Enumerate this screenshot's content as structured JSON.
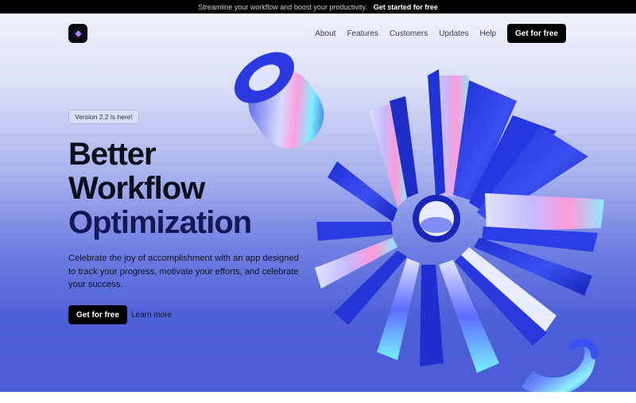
{
  "announcement": {
    "text": "Streamline your workflow and boost your productivity.",
    "cta": "Get started for free"
  },
  "nav": {
    "items": [
      "About",
      "Features",
      "Customers",
      "Updates",
      "Help"
    ],
    "cta": "Get for free"
  },
  "hero": {
    "badge": "Version 2.2 is here!",
    "title_line1": "Better",
    "title_line2": "Workflow",
    "title_line3": "Optimization",
    "description": "Celebrate the joy of accomplishment with an app designed to track your progress, motivate your efforts, and celebrate your success.",
    "primary_cta": "Get for free",
    "secondary_cta": "Learn more"
  },
  "colors": {
    "accent": "#2f3fd8",
    "title_accent": "#0e1a56",
    "button": "#000000"
  },
  "icons": {
    "logo": "diamond-logo-icon"
  }
}
